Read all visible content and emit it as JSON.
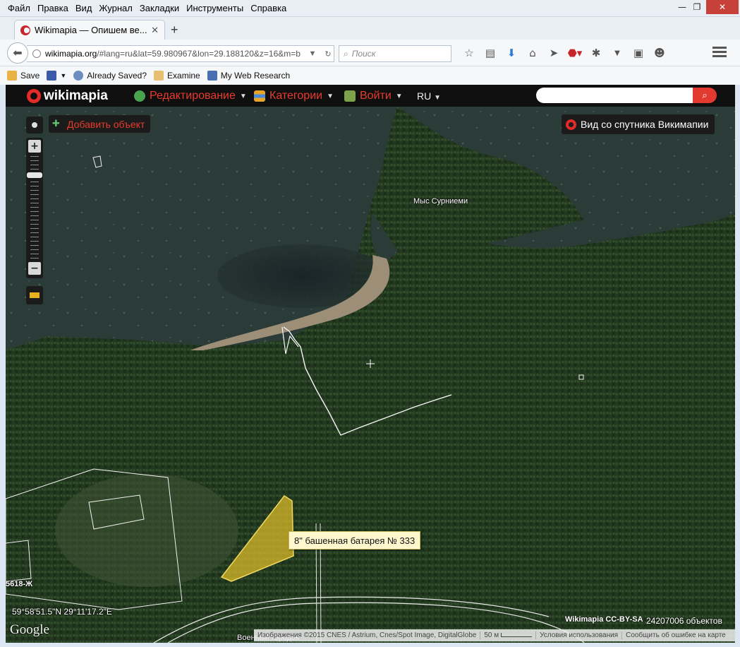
{
  "menu": [
    "Файл",
    "Правка",
    "Вид",
    "Журнал",
    "Закладки",
    "Инструменты",
    "Справка"
  ],
  "tab": {
    "title": "Wikimapia — Опишем ве..."
  },
  "url": {
    "host": "wikimapia.org",
    "rest": "/#lang=ru&lat=59.980967&lon=29.188120&z=16&m=b"
  },
  "search": {
    "placeholder": "Поиск"
  },
  "bookmarks": [
    {
      "label": "Save"
    },
    {
      "label": ""
    },
    {
      "label": "Already Saved?"
    },
    {
      "label": "Examine"
    },
    {
      "label": "My Web Research"
    }
  ],
  "wikimapia": {
    "logo": "wikimapia",
    "menu": [
      {
        "label": "Редактирование",
        "icon": "edit-icon"
      },
      {
        "label": "Категории",
        "icon": "categories-icon"
      },
      {
        "label": "Войти",
        "icon": "login-icon"
      }
    ],
    "lang": "RU"
  },
  "map": {
    "add_object": "Добавить объект",
    "satellite_view": "Вид со спутника Викимапии",
    "place_label": "Мыс Сурниеми",
    "tooltip": "8\" башенная батарея № 333",
    "road_label": "5618-Ж",
    "bottom_label": "Военный городок",
    "coords": "59°58'51.5\"N 29°11'17.2\"E",
    "google": "Google",
    "license": "Wikimapia CC-BY-SA",
    "objects_count": "24207006 объектов",
    "footer": {
      "imagery": "Изображения ©2015 CNES / Astrium, Cnes/Spot Image, DigitalGlobe",
      "scale": "50 м",
      "terms": "Условия использования",
      "report": "Сообщить об ошибке на карте"
    }
  },
  "colors": {
    "accent": "#e93b2b",
    "highlight_polygon": "#d9b92a"
  }
}
